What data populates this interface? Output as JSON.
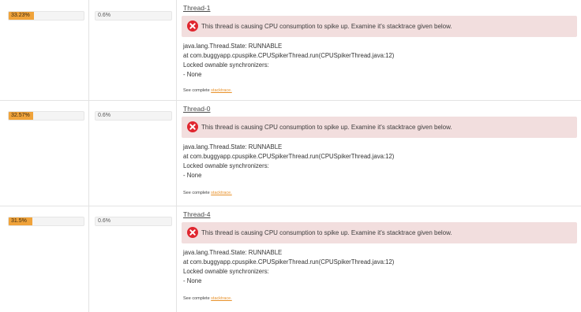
{
  "threads": [
    {
      "cpu_percent_label": "33.23%",
      "cpu_percent": 33.23,
      "second_label": "0.6%",
      "second_percent": 0.6,
      "name": "Thread-1",
      "alert": "This thread is causing CPU consumption to spike up. Examine it's stacktrace given below.",
      "stack": [
        "java.lang.Thread.State: RUNNABLE",
        "at com.buggyapp.cpuspike.CPUSpikerThread.run(CPUSpikerThread.java:12)",
        "Locked ownable synchronizers:",
        "- None"
      ],
      "see_complete_prefix": "See complete ",
      "see_complete_link": "stacktrace."
    },
    {
      "cpu_percent_label": "32.57%",
      "cpu_percent": 32.57,
      "second_label": "0.6%",
      "second_percent": 0.6,
      "name": "Thread-0",
      "alert": "This thread is causing CPU consumption to spike up. Examine it's stacktrace given below.",
      "stack": [
        "java.lang.Thread.State: RUNNABLE",
        "at com.buggyapp.cpuspike.CPUSpikerThread.run(CPUSpikerThread.java:12)",
        "Locked ownable synchronizers:",
        "- None"
      ],
      "see_complete_prefix": "See complete ",
      "see_complete_link": "stacktrace."
    },
    {
      "cpu_percent_label": "31.5%",
      "cpu_percent": 31.5,
      "second_label": "0.6%",
      "second_percent": 0.6,
      "name": "Thread-4",
      "alert": "This thread is causing CPU consumption to spike up. Examine it's stacktrace given below.",
      "stack": [
        "java.lang.Thread.State: RUNNABLE",
        "at com.buggyapp.cpuspike.CPUSpikerThread.run(CPUSpikerThread.java:12)",
        "Locked ownable synchronizers:",
        "- None"
      ],
      "see_complete_prefix": "See complete ",
      "see_complete_link": "stacktrace."
    }
  ],
  "colors": {
    "cpu_bar": "#f0a33a",
    "alert_bg": "#f2dede",
    "alert_icon": "#e0262f",
    "link": "#e8912a"
  },
  "icons": {
    "alert": "error-circle-x-icon"
  }
}
